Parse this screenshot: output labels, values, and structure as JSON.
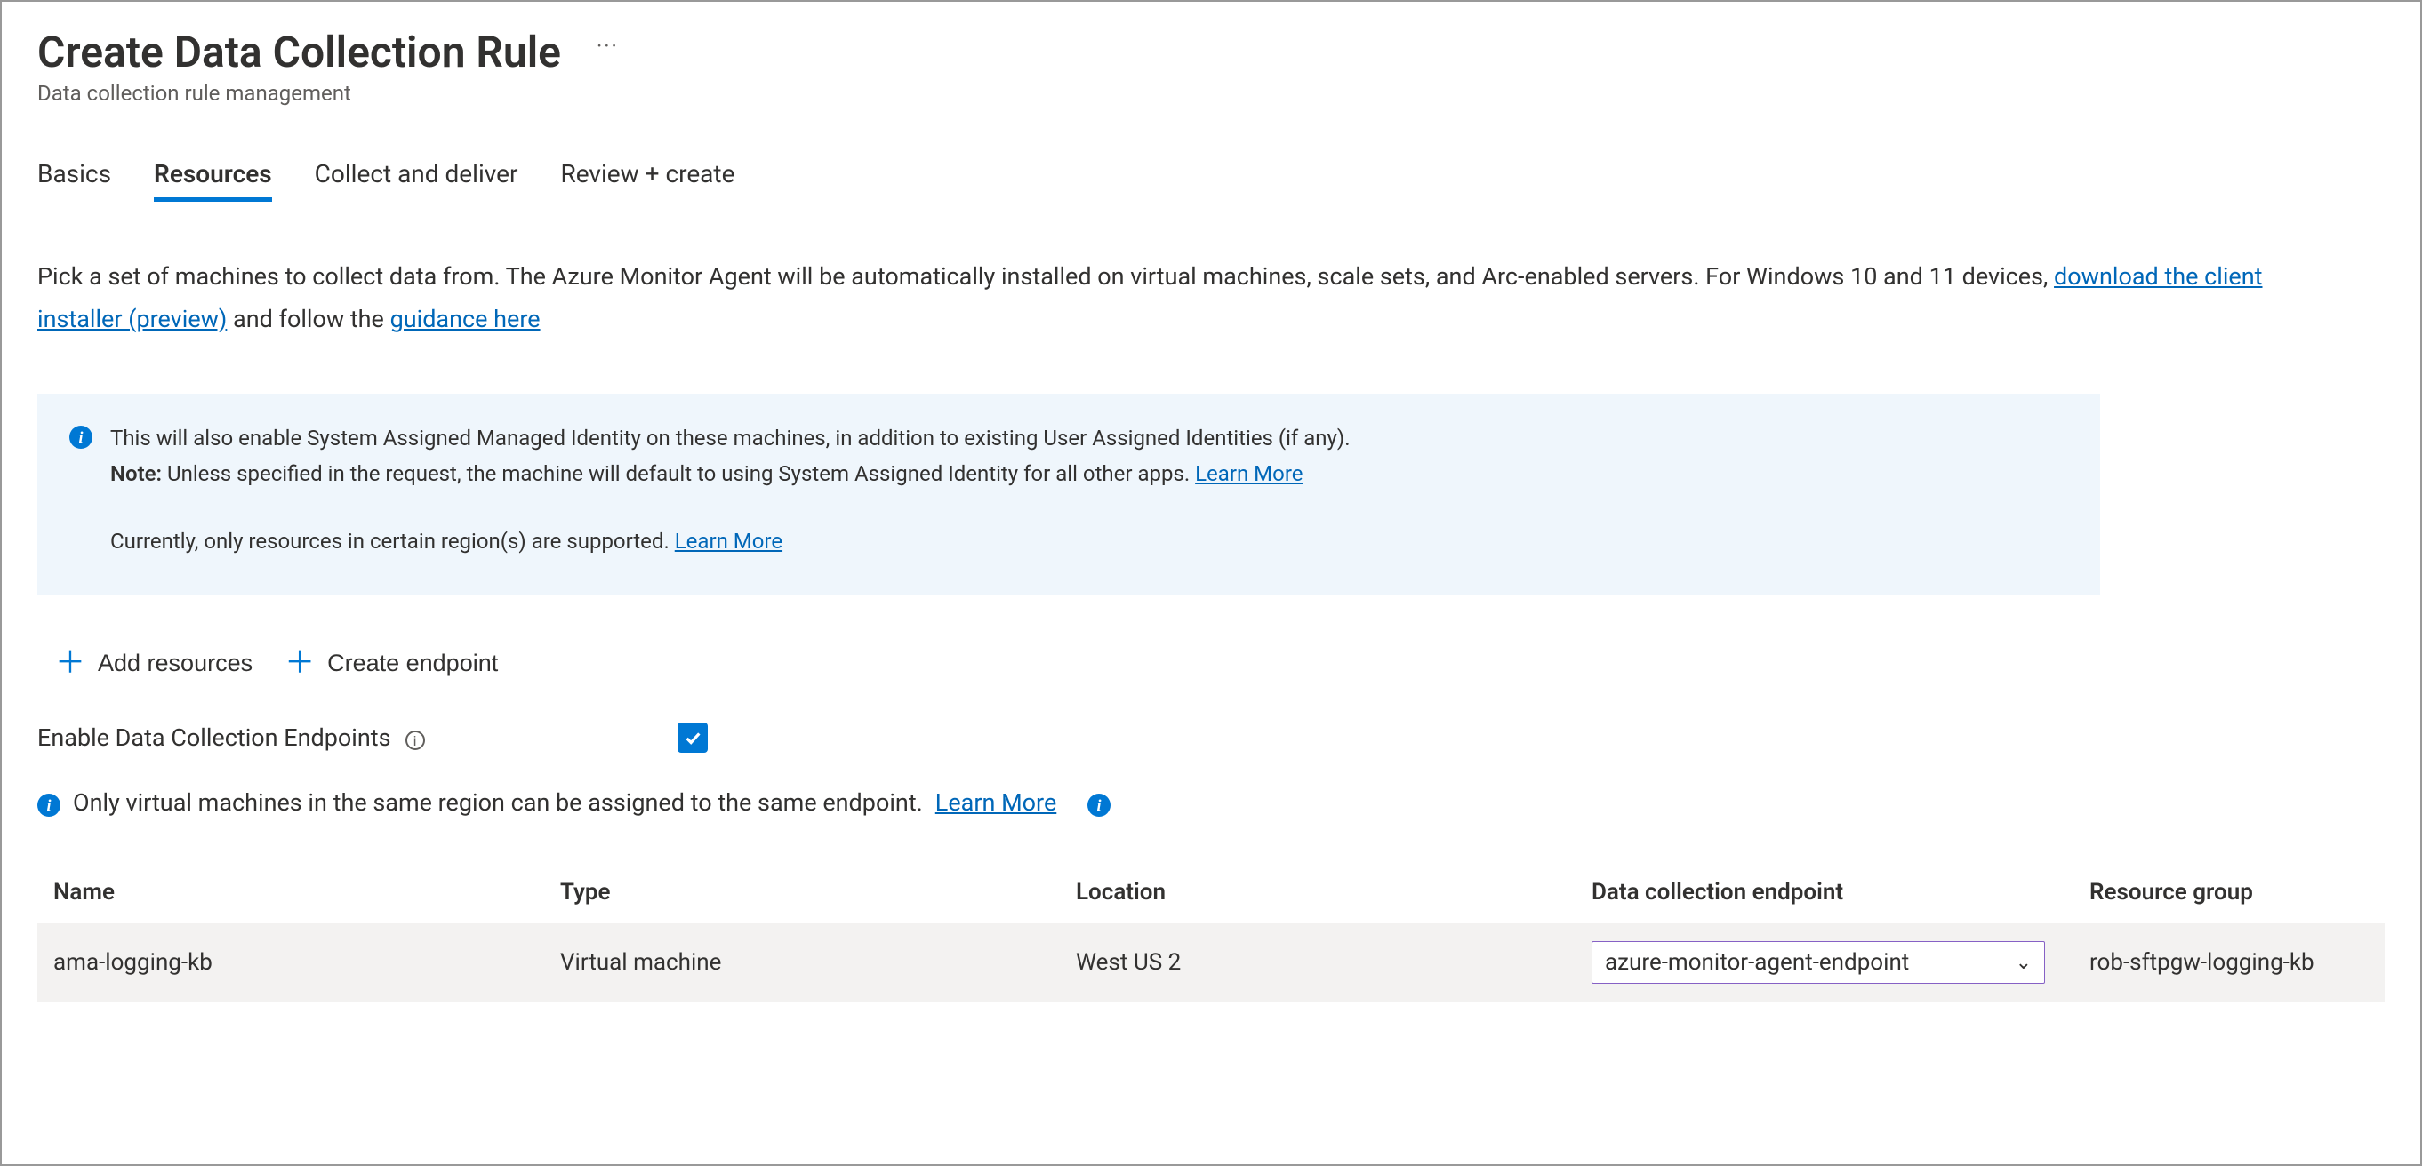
{
  "header": {
    "title": "Create Data Collection Rule",
    "subtitle": "Data collection rule management"
  },
  "tabs": [
    {
      "label": "Basics",
      "active": false
    },
    {
      "label": "Resources",
      "active": true
    },
    {
      "label": "Collect and deliver",
      "active": false
    },
    {
      "label": "Review + create",
      "active": false
    }
  ],
  "intro": {
    "part1": "Pick a set of machines to collect data from. The Azure Monitor Agent will be automatically installed on virtual machines, scale sets, and Arc-enabled servers. For Windows 10 and 11 devices, ",
    "link1": "download the client installer (preview)",
    "part2": " and follow the ",
    "link2": "guidance here"
  },
  "info_box": {
    "line1": "This will also enable System Assigned Managed Identity on these machines, in addition to existing User Assigned Identities (if any).",
    "note_label": "Note:",
    "note_text": " Unless specified in the request, the machine will default to using System Assigned Identity for all other apps. ",
    "learn_more_1": "Learn More",
    "line2": "Currently, only resources in certain region(s) are supported. ",
    "learn_more_2": "Learn More"
  },
  "actions": {
    "add_resources": "Add resources",
    "create_endpoint": "Create endpoint"
  },
  "toggle": {
    "label": "Enable Data Collection Endpoints",
    "checked": true
  },
  "endpoint_note": {
    "text": "Only virtual machines in the same region can be assigned to the same endpoint. ",
    "learn_more": "Learn More"
  },
  "table": {
    "columns": [
      "Name",
      "Type",
      "Location",
      "Data collection endpoint",
      "Resource group"
    ],
    "rows": [
      {
        "name": "ama-logging-kb",
        "type": "Virtual machine",
        "location": "West US 2",
        "endpoint_selected": "azure-monitor-agent-endpoint",
        "resource_group": "rob-sftpgw-logging-kb"
      }
    ]
  }
}
